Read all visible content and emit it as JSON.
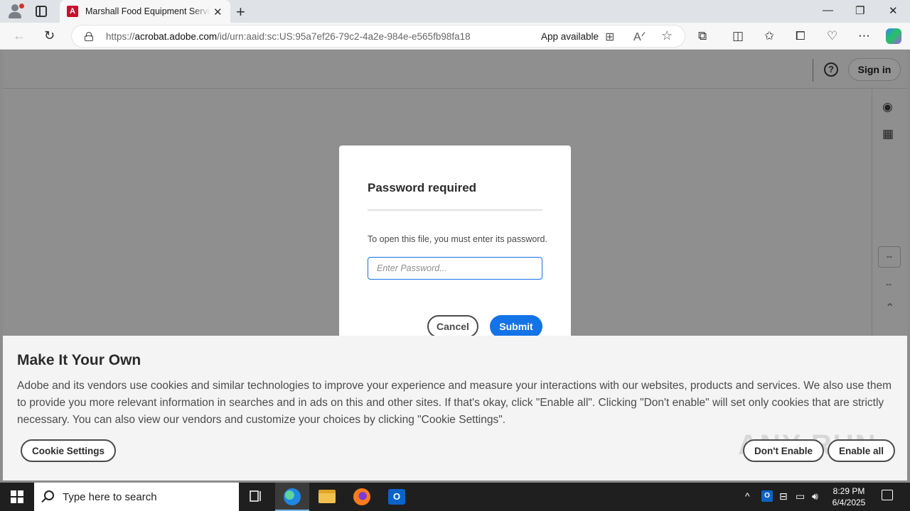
{
  "browser": {
    "tab_title": "Marshall Food Equipment Services",
    "tab_close": "✕",
    "new_tab": "+",
    "window_controls": {
      "minimize": "—",
      "restore": "❐",
      "close": "✕"
    },
    "url_prefix": "https://",
    "url_host": "acrobat.adobe.com",
    "url_path": "/id/urn:aaid:sc:US:95a7ef26-79c2-4a2e-984e-e565fb98fa18",
    "app_available": "App available",
    "nav": {
      "back": "←",
      "refresh": "↻"
    }
  },
  "page_header": {
    "help": "?",
    "sign_in": "Sign in"
  },
  "rail": {
    "more_box": "--",
    "more": "--",
    "up": "⌃",
    "comment": "◉",
    "grid": "▦"
  },
  "dialog": {
    "title": "Password required",
    "message": "To open this file, you must enter its password.",
    "password_placeholder": "Enter Password...",
    "cancel": "Cancel",
    "submit": "Submit"
  },
  "cookie": {
    "title": "Make It Your Own",
    "text": "Adobe and its vendors use cookies and similar technologies to improve your experience and measure your interactions with our websites, products and services. We also use them to provide you more relevant information in searches and in ads on this and other sites. If that's okay, click \"Enable all\". Clicking \"Don't enable\" will set only cookies that are strictly necessary. You can also view our vendors and customize your choices by clicking \"Cookie Settings\".",
    "settings": "Cookie Settings",
    "dont_enable": "Don't Enable",
    "enable_all": "Enable all",
    "watermark": "ANY RUN"
  },
  "taskbar": {
    "search_placeholder": "Type here to search",
    "outlook_letter": "O",
    "tray_chevron": "^",
    "time": "8:29 PM",
    "date": "6/4/2025"
  },
  "colors": {
    "accent": "#1473e6",
    "adobe_red": "#c8102e",
    "overlay_gray": "#8f8f8f"
  }
}
